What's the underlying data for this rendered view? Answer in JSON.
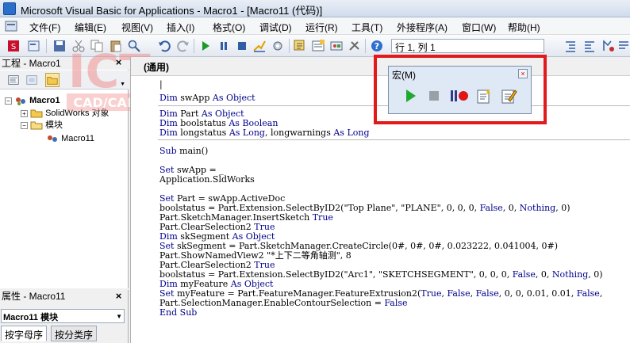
{
  "window": {
    "title": "Microsoft Visual Basic for Applications - Macro1 - [Macro11 (代码)]"
  },
  "menu": {
    "items": [
      "文件(F)",
      "编辑(E)",
      "视图(V)",
      "插入(I)",
      "格式(O)",
      "调试(D)",
      "运行(R)",
      "工具(T)",
      "外接程序(A)",
      "窗口(W)",
      "帮助(H)"
    ]
  },
  "toolbar": {
    "position_text": "行 1, 列 1"
  },
  "project_pane": {
    "title": "工程 - Macro1",
    "tree": [
      {
        "label": "Macro1"
      },
      {
        "label": "SolidWorks 对象"
      },
      {
        "label": "模块"
      },
      {
        "label": "Macro11"
      }
    ]
  },
  "watermark": {
    "text": "ICT",
    "subtext": "CAD/CAM"
  },
  "properties_pane": {
    "title": "属性 - Macro11",
    "selected_object": "Macro11 模块",
    "tabs": [
      "按字母序",
      "按分类序"
    ]
  },
  "code_window": {
    "procedure_combo": "(通用)",
    "lines": [
      "|",
      "Dim swApp As Object",
      "",
      "Dim Part As Object",
      "Dim boolstatus As Boolean",
      "Dim longstatus As Long, longwarnings As Long",
      "",
      "Sub main()",
      "",
      "Set swApp = _",
      "Application.SldWorks",
      "",
      "Set Part = swApp.ActiveDoc",
      "boolstatus = Part.Extension.SelectByID2(\"Top Plane\", \"PLANE\", 0, 0, 0, False, 0, Nothing, 0)",
      "Part.SketchManager.InsertSketch True",
      "Part.ClearSelection2 True",
      "Dim skSegment As Object",
      "Set skSegment = Part.SketchManager.CreateCircle(0#, 0#, 0#, 0.023222, 0.041004, 0#)",
      "Part.ShowNamedView2 \"*上下二等角轴测\", 8",
      "Part.ClearSelection2 True",
      "boolstatus = Part.Extension.SelectByID2(\"Arc1\", \"SKETCHSEGMENT\", 0, 0, 0, False, 0, Nothing, 0)",
      "Dim myFeature As Object",
      "Set myFeature = Part.FeatureManager.FeatureExtrusion2(True, False, False, 0, 0, 0.01, 0.01, False,",
      "Part.SelectionManager.EnableContourSelection = False",
      "End Sub"
    ]
  },
  "macro_toolbar": {
    "title": "宏(M)"
  },
  "colors": {
    "highlight": "#e11b1b",
    "keyword": "#00008b"
  }
}
